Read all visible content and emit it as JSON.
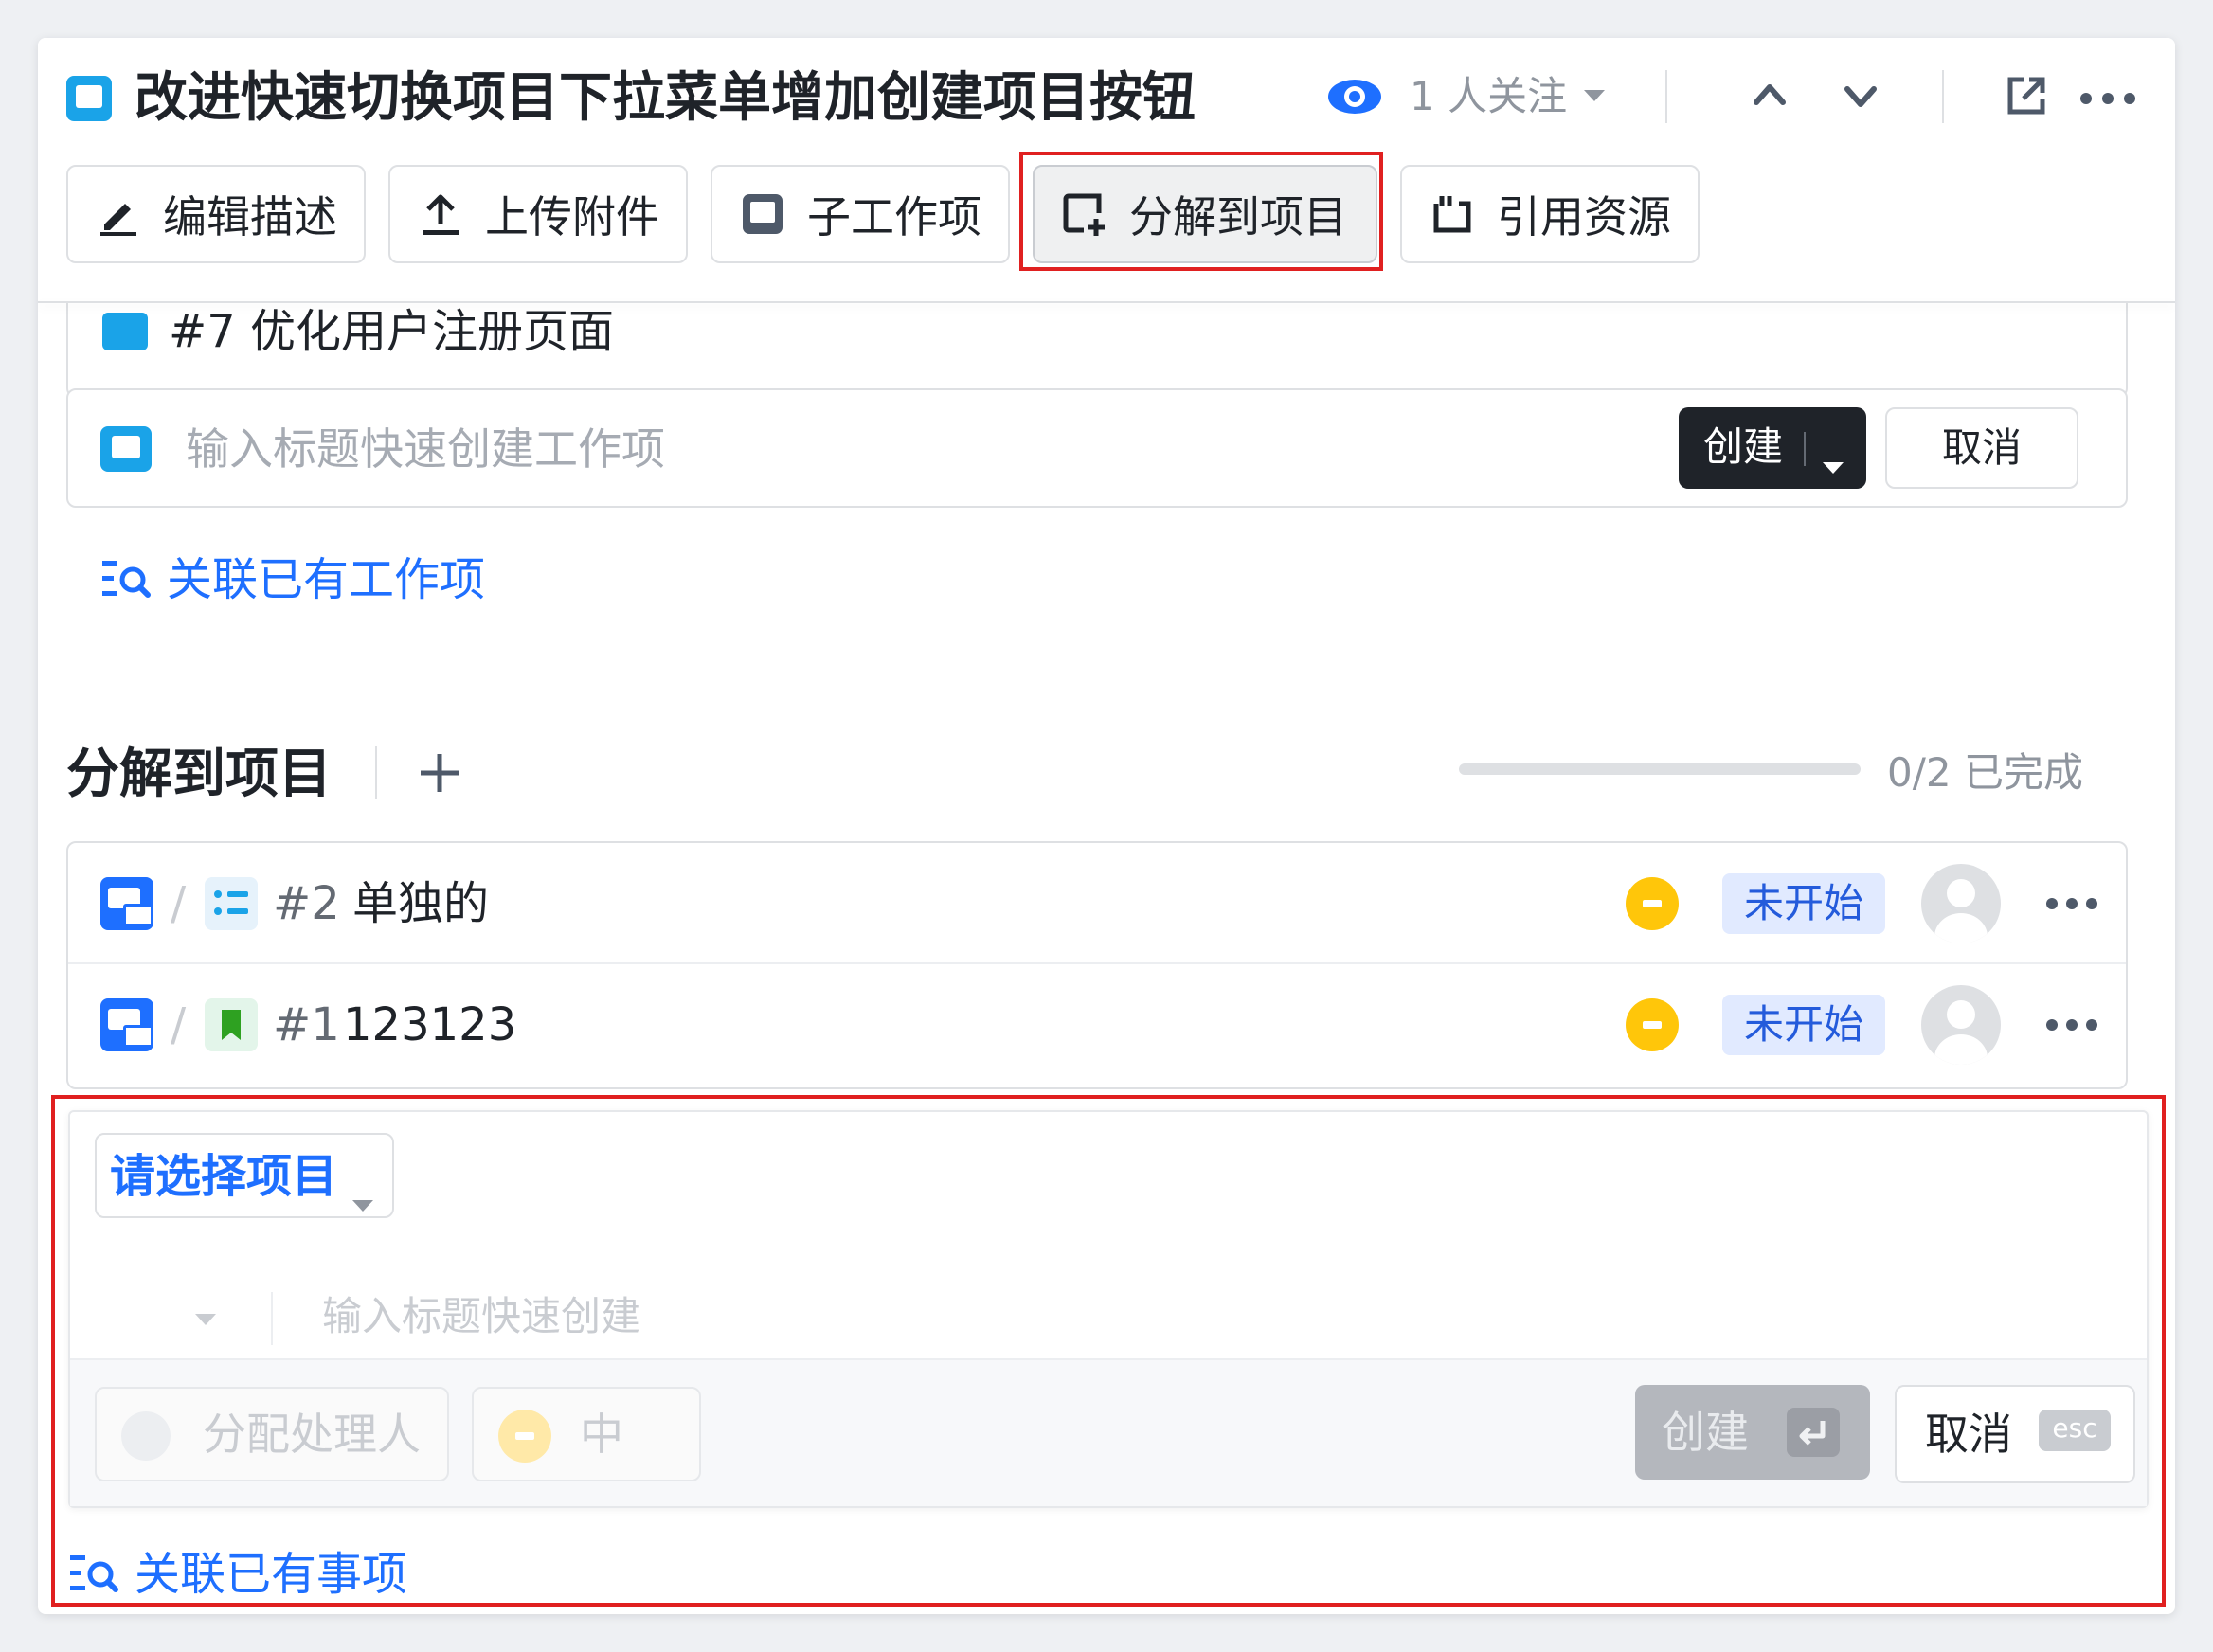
{
  "header": {
    "title": "改进快速切换项目下拉菜单增加创建项目按钮",
    "watchers": "1 人关注",
    "icons": {
      "watch": "eye-icon",
      "dropdown": "caret-down-icon",
      "prev": "chevron-up-icon",
      "next": "chevron-down-icon",
      "open": "external-link-icon",
      "more": "more-icon"
    }
  },
  "toolbar": {
    "edit_desc": "编辑描述",
    "upload": "上传附件",
    "subtask": "子工作项",
    "split_to_project": "分解到项目",
    "reference": "引用资源"
  },
  "subitems": {
    "partial_row_text": "#7 优化用户注册页面",
    "quick_create_placeholder": "输入标题快速创建工作项",
    "create_label": "创建",
    "cancel_label": "取消",
    "link_existing": "关联已有工作项"
  },
  "split_section": {
    "title": "分解到项目",
    "add_symbol": "+",
    "progress_text": "0/2 已完成",
    "progress_value": 0,
    "rows": [
      {
        "num": "#2",
        "name": "单独的",
        "status": "未开始",
        "type_icon": "list-icon"
      },
      {
        "num": "#1",
        "name": "123123",
        "status": "未开始",
        "type_icon": "bookmark-icon"
      }
    ]
  },
  "create_panel": {
    "project_select": "请选择项目",
    "title_placeholder": "输入标题快速创建",
    "assignee": "分配处理人",
    "priority": "中",
    "create_label": "创建",
    "cancel_label": "取消",
    "esc_key": "esc",
    "link_existing": "关联已有事项"
  },
  "colors": {
    "accent": "#1e6fff",
    "highlight": "#e02020",
    "priority_medium": "#ffc60a",
    "status_bg": "#e1eaff",
    "dark_button": "#1f2329"
  }
}
